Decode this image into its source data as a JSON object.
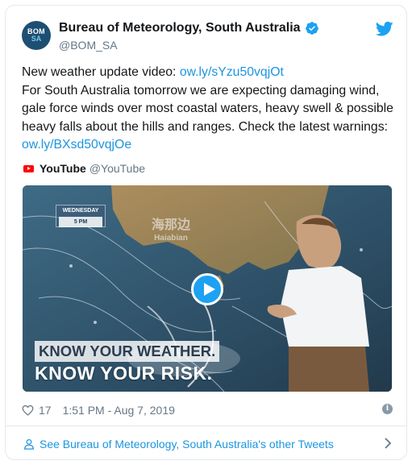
{
  "account": {
    "avatar_line1": "BOM",
    "avatar_line2": "SA",
    "display_name": "Bureau of Meteorology, South Australia",
    "handle": "@BOM_SA",
    "verified": true
  },
  "tweet": {
    "line1_text": "New weather update video: ",
    "line1_link": "ow.ly/sYzu50vqjOt",
    "body_text": "For South Australia tomorrow we are expecting damaging wind, gale force winds over most coastal waters, heavy swell & possible heavy falls about the hills and ranges. Check the latest warnings: ",
    "body_link": "ow.ly/BXsd50vqjOe"
  },
  "embed": {
    "source_name": "YouTube",
    "source_handle": "@YouTube",
    "video": {
      "day_label": "WEDNESDAY",
      "time_label": "5 PM",
      "watermark_top": "海那边",
      "watermark_bottom": "Haiabian",
      "banner_line1": "KNOW YOUR WEATHER.",
      "banner_line2": "KNOW YOUR RISK."
    }
  },
  "footer": {
    "likes": "17",
    "timestamp": "1:51 PM - Aug 7, 2019",
    "info_icon": "i"
  },
  "more_tweets": {
    "label": "See Bureau of Meteorology, South Australia's other Tweets"
  },
  "colors": {
    "link": "#1b95e0",
    "play_button": "#1da1f2",
    "avatar_bg": "#1d4f73",
    "verified": "#1da1f2"
  }
}
